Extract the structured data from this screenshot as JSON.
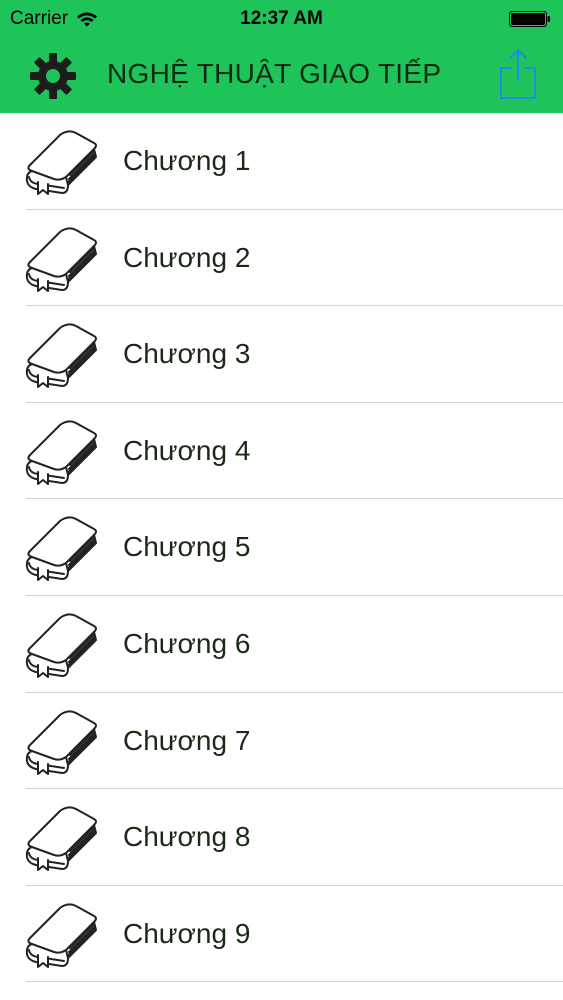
{
  "status_bar": {
    "carrier": "Carrier",
    "time": "12:37 AM",
    "wifi_icon": "wifi-icon",
    "battery_icon": "battery-icon"
  },
  "nav_bar": {
    "title": "NGHỆ THUẬT GIAO TIẾP",
    "left_icon": "gear-icon",
    "right_icon": "share-icon",
    "background_color": "#1ec35a",
    "title_color": "#0d2a14"
  },
  "chapters": [
    {
      "label": "Chương 1",
      "icon": "book-icon"
    },
    {
      "label": "Chương 2",
      "icon": "book-icon"
    },
    {
      "label": "Chương 3",
      "icon": "book-icon"
    },
    {
      "label": "Chương 4",
      "icon": "book-icon"
    },
    {
      "label": "Chương 5",
      "icon": "book-icon"
    },
    {
      "label": "Chương 6",
      "icon": "book-icon"
    },
    {
      "label": "Chương 7",
      "icon": "book-icon"
    },
    {
      "label": "Chương 8",
      "icon": "book-icon"
    },
    {
      "label": "Chương 9",
      "icon": "book-icon"
    }
  ]
}
